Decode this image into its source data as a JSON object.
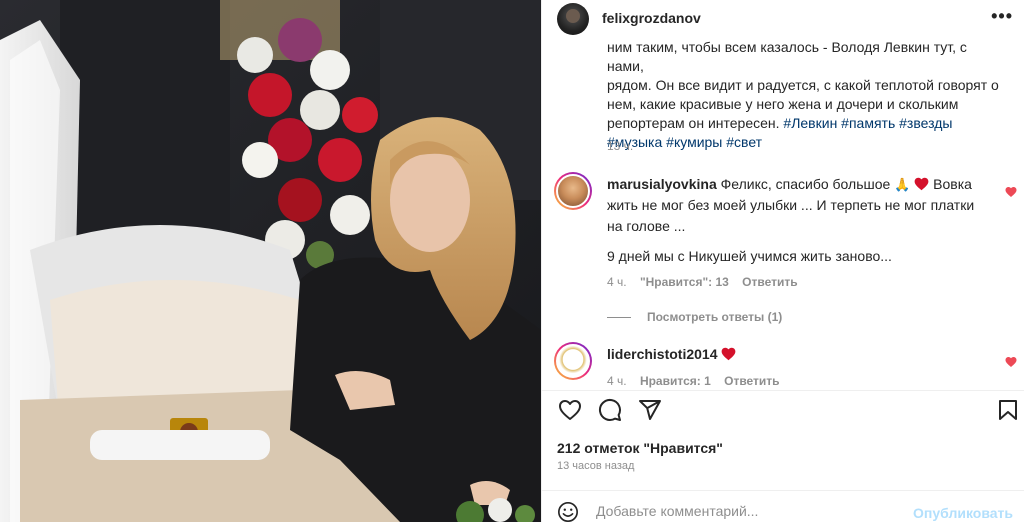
{
  "post": {
    "username": "felixgrozdanov",
    "caption_lines": [
      "ним таким, чтобы всем казалось - Володя Левкин тут, с нами,",
      "рядом. Он все видит и радуется, с какой теплотой говорят о",
      "нем, какие красивые у него жена и дочери и скольким"
    ],
    "caption_last": "репортерам он интересен.",
    "caption_tags_inline": "#Левкин #память #звезды",
    "caption_tags_line": "#музыка #кумиры #свет",
    "caption_time": "13 ч."
  },
  "comments": [
    {
      "username": "marusialyovkina",
      "text_a": "Феликс, спасибо большое",
      "text_b": "Вовка жить не мог без моей улыбки ... И терпеть не мог платки на голове ...",
      "text_c": "9 дней мы с Никушей учимся жить заново...",
      "time": "4 ч.",
      "likes": "\"Нравится\": 13",
      "reply": "Ответить"
    },
    {
      "username": "liderchistoti2014",
      "time": "4 ч.",
      "likes": "Нравится: 1",
      "reply": "Ответить"
    }
  ],
  "view_replies": "Посмотреть ответы (1)",
  "like_count": "212 отметок \"Нравится\"",
  "post_time": "13 часов назад",
  "comment_placeholder": "Добавьте комментарий...",
  "publish_label": "Опубликовать",
  "more_label": "•••",
  "colors": {
    "heart": "#ed4956",
    "tags": "#00376b",
    "publish": "#b2dffc"
  },
  "icons": [
    "heart-icon",
    "comment-icon",
    "share-icon",
    "bookmark-icon",
    "emoji-icon",
    "more-icon"
  ]
}
